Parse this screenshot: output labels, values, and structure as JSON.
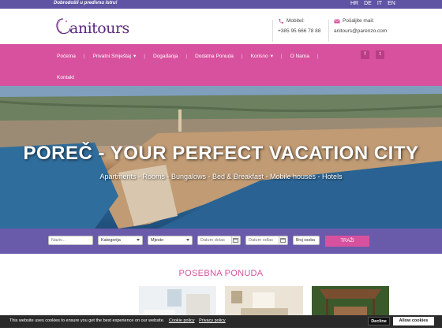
{
  "topbar": {
    "welcome": "Dobrodošli u predivnu Istru!",
    "languages": [
      "HR",
      "DE",
      "IT",
      "EN"
    ]
  },
  "logo": {
    "text": "anitours"
  },
  "contact": {
    "phone_label": "Mobitel:",
    "phone_value": "+385 95 666 78 88",
    "mail_label": "Pošaljite mail:",
    "mail_value": "anitours@parenzo.com"
  },
  "nav": {
    "items": [
      {
        "label": "Početna"
      },
      {
        "label": "Privatni Smještaj"
      },
      {
        "label": "Događanja"
      },
      {
        "label": "Dodatna Ponuda"
      },
      {
        "label": "Korisno"
      },
      {
        "label": "O Nama"
      },
      {
        "label": "Kontakt"
      }
    ],
    "social": [
      {
        "icon": "facebook-icon",
        "glyph": "f"
      },
      {
        "icon": "twitter-icon",
        "glyph": "t"
      }
    ]
  },
  "hero": {
    "title": "POREČ - YOUR PERFECT VACATION CITY",
    "subtitle": "Apartments - Rooms - Bungalows - Bed & Breakfast - Mobile houses - Hotels"
  },
  "search": {
    "naziv_placeholder": "Naziv...",
    "kategorija_value": "Kategorija",
    "mjesto_value": "Mjesto",
    "datum_dolaska_placeholder": "Datum dolas",
    "datum_odlaska_placeholder": "Datum odlas",
    "broj_osoba_value": "Broj osoba",
    "submit_label": "TRAŽI"
  },
  "offer": {
    "title": "POSEBNA PONUDA"
  },
  "cookie": {
    "message": "This website uses cookies to ensure you get the best experience on our website.",
    "policy_link": "Cookie policy",
    "privacy_link": "Privacy policy",
    "decline_label": "Decline",
    "allow_label": "Allow cookies"
  },
  "colors": {
    "topbar": "#5e54a3",
    "nav": "#d8519e",
    "search_bar": "#6a5aaa",
    "accent": "#d8519e"
  }
}
